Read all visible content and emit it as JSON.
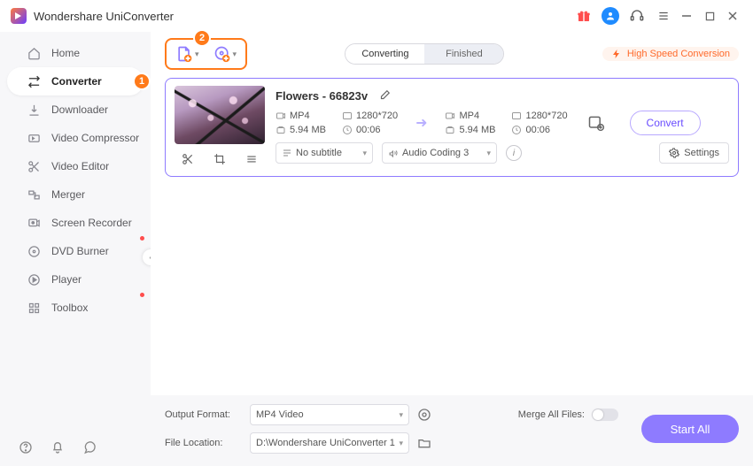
{
  "app": {
    "title": "Wondershare UniConverter"
  },
  "titlebar_icons": {
    "gift": "gift-icon",
    "avatar": "user-avatar",
    "headset": "support-icon",
    "menu": "hamburger-icon"
  },
  "sidebar": {
    "items": [
      {
        "label": "Home"
      },
      {
        "label": "Converter"
      },
      {
        "label": "Downloader"
      },
      {
        "label": "Video Compressor"
      },
      {
        "label": "Video Editor"
      },
      {
        "label": "Merger"
      },
      {
        "label": "Screen Recorder"
      },
      {
        "label": "DVD Burner"
      },
      {
        "label": "Player"
      },
      {
        "label": "Toolbox"
      }
    ]
  },
  "callouts": {
    "one": "1",
    "two": "2"
  },
  "tabs": {
    "converting": "Converting",
    "finished": "Finished"
  },
  "highspeed": "High Speed Conversion",
  "file": {
    "name": "Flowers - 66823v",
    "src": {
      "format": "MP4",
      "res": "1280*720",
      "size": "5.94 MB",
      "dur": "00:06"
    },
    "dst": {
      "format": "MP4",
      "res": "1280*720",
      "size": "5.94 MB",
      "dur": "00:06"
    },
    "subtitle": "No subtitle",
    "audio": "Audio Coding 3",
    "settings": "Settings",
    "convert": "Convert"
  },
  "footer": {
    "output_format_label": "Output Format:",
    "output_format": "MP4 Video",
    "merge_label": "Merge All Files:",
    "file_location_label": "File Location:",
    "file_location": "D:\\Wondershare UniConverter 1",
    "start_all": "Start All"
  }
}
